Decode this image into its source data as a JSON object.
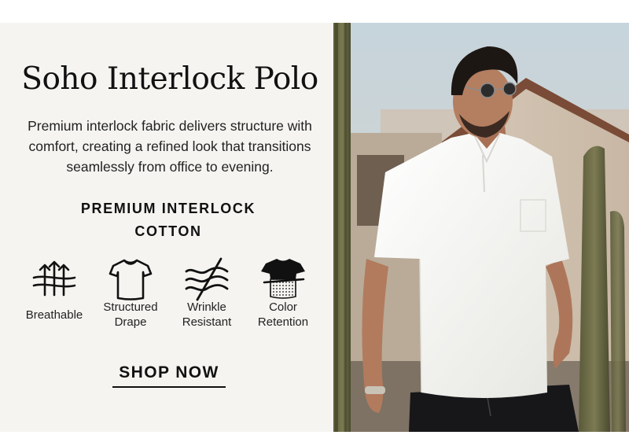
{
  "product": {
    "title": "Soho Interlock Polo",
    "description": "Premium interlock fabric delivers structure with comfort, creating a refined look that transitions seamlessly from office to evening.",
    "subheading": "PREMIUM INTERLOCK COTTON"
  },
  "features": [
    {
      "label": "Breathable",
      "icon": "breathable-arrows-icon"
    },
    {
      "label": "Structured Drape",
      "icon": "tshirt-outline-icon"
    },
    {
      "label": "Wrinkle Resistant",
      "icon": "wrinkle-resistant-waves-icon"
    },
    {
      "label": "Color Retention",
      "icon": "color-retention-tshirt-icon"
    }
  ],
  "cta": {
    "label": "SHOP NOW"
  },
  "colors": {
    "banner_background": "#f5f4f1",
    "text": "#111111",
    "polo_shirt": "#f7f7f4"
  }
}
